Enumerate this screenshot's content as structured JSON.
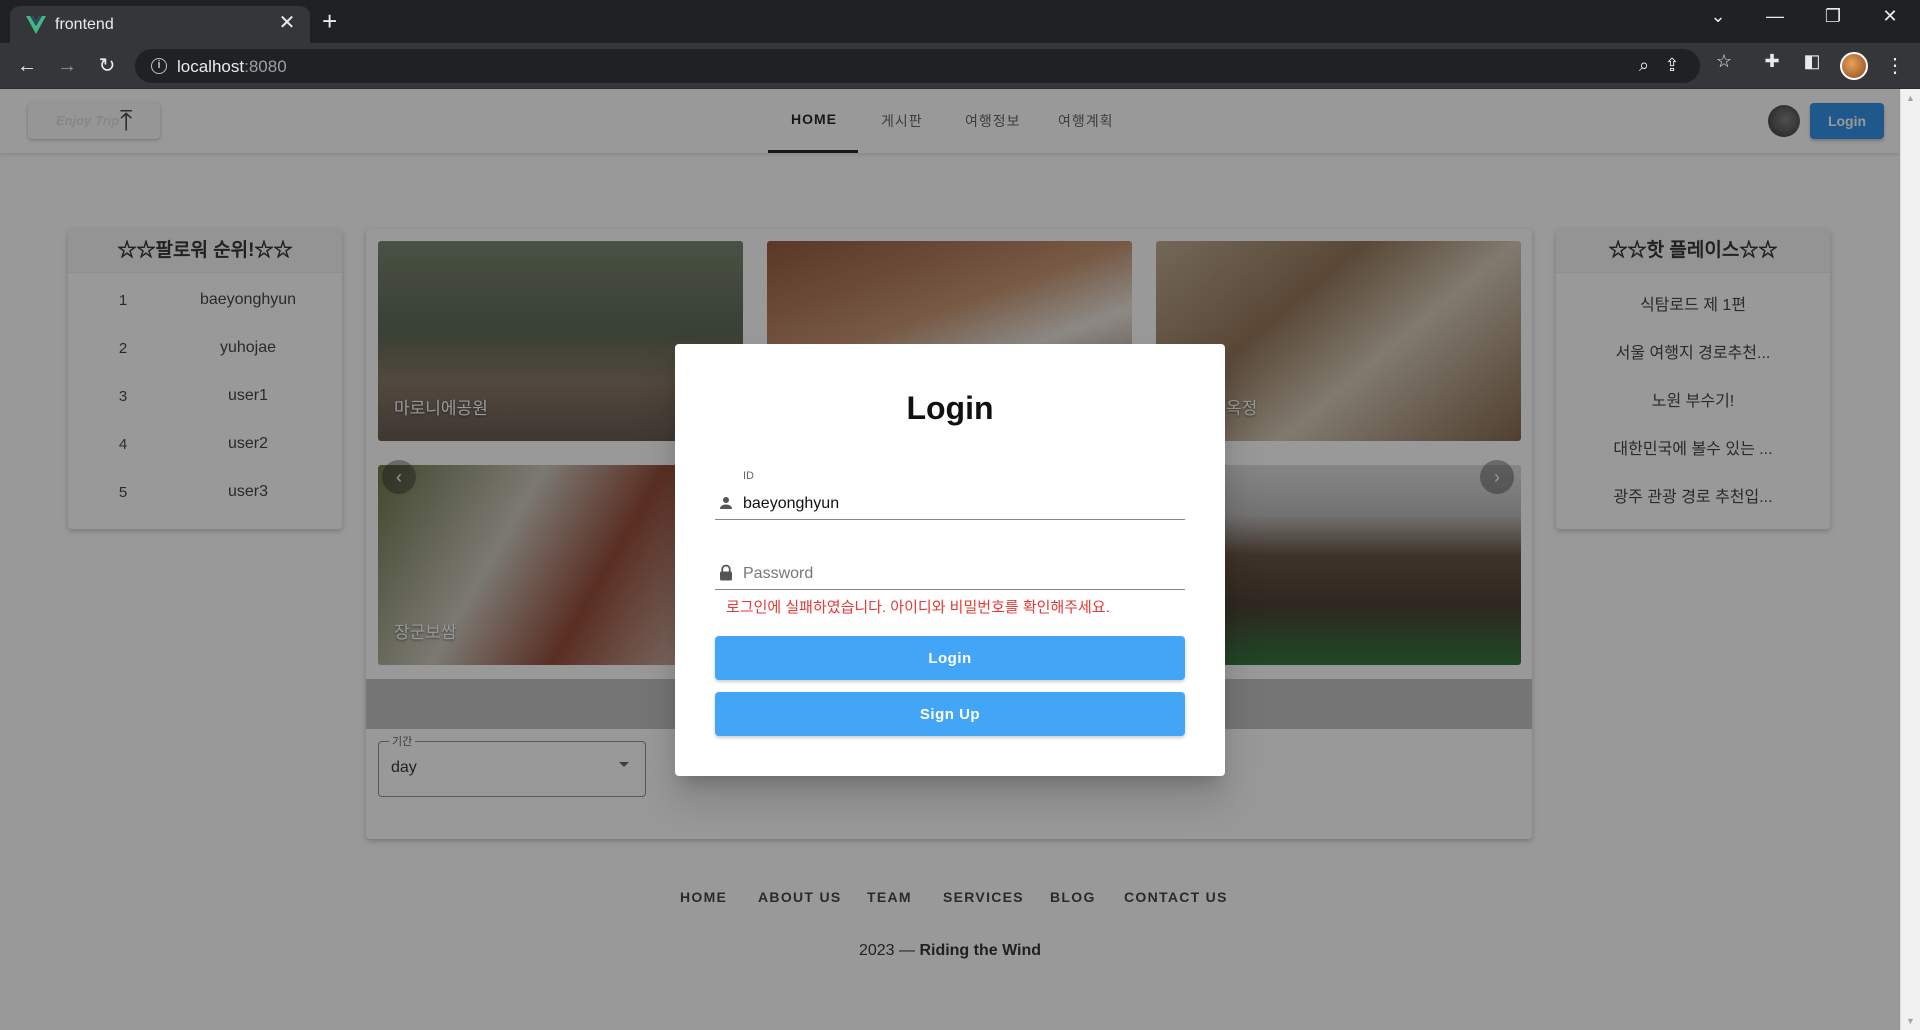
{
  "browser": {
    "tab_title": "frontend",
    "url_host": "localhost",
    "url_port": ":8080"
  },
  "app": {
    "nav": [
      "HOME",
      "게시판",
      "여행정보",
      "여행계획"
    ],
    "login_label": "Login"
  },
  "follower_rank": {
    "title": "☆☆팔로워 순위!☆☆",
    "items": [
      {
        "rank": "1",
        "name": "baeyonghyun"
      },
      {
        "rank": "2",
        "name": "yuhojae"
      },
      {
        "rank": "3",
        "name": "user1"
      },
      {
        "rank": "4",
        "name": "user2"
      },
      {
        "rank": "5",
        "name": "user3"
      }
    ]
  },
  "hot_places": {
    "title": "☆☆핫 플레이스☆☆",
    "items": [
      "식탐로드 제 1편",
      "서울 여행지 경로추천...",
      "노원 부수기!",
      "대한민국에 볼수 있는 ...",
      "광주 관광 경로 추천입..."
    ]
  },
  "gallery": {
    "labels": [
      "마로니에공원",
      "",
      "옥정",
      "장군보쌈",
      "",
      ""
    ]
  },
  "period_select": {
    "legend": "기간",
    "value": "day"
  },
  "footer": {
    "links": [
      "HOME",
      "ABOUT US",
      "TEAM",
      "SERVICES",
      "BLOG",
      "CONTACT US"
    ],
    "year": "2023 — ",
    "brand": "Riding the Wind"
  },
  "login_modal": {
    "title": "Login",
    "id_label": "ID",
    "id_value": "baeyonghyun",
    "password_placeholder": "Password",
    "error": "로그인에 실패하였습니다. 아이디와 비밀번호를 확인해주세요.",
    "login_button": "Login",
    "signup_button": "Sign Up"
  },
  "colors": {
    "primary": "#1e88e5",
    "modal_button": "#42a5f5",
    "error": "#e53935"
  }
}
